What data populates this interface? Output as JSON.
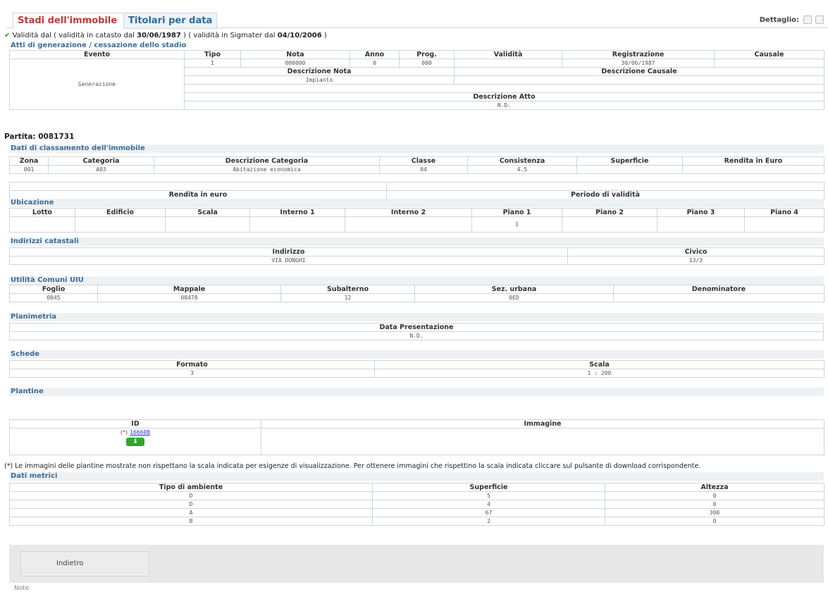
{
  "tabs": {
    "active": "Stadi dell'immobile",
    "inactive": "Titolari per data"
  },
  "detail_label": "Dettaglio:",
  "validity": {
    "prefix": "Validità dal",
    "text1": "( validità in catasto dal",
    "date1": "30/06/1987",
    "text2": ") ( validità in Sigmater dal",
    "date2": "04/10/2006",
    "text3": ")"
  },
  "atti": {
    "title": "Atti di generazione / cessazione dello stadio",
    "headers": [
      "Evento",
      "Tipo",
      "Nota",
      "Anno",
      "Prog.",
      "Validità",
      "Registrazione",
      "Causale"
    ],
    "evento": "Generazione",
    "row": [
      "I",
      "000000",
      "0",
      "000",
      "",
      "30/06/1987",
      ""
    ],
    "desc_nota_h": "Descrizione Nota",
    "desc_nota": "Impianto",
    "desc_causale_h": "Descrizione Causale",
    "desc_atto_h": "Descrizione Atto",
    "desc_atto": "N.D."
  },
  "partita": "Partita: 0081731",
  "classamento": {
    "title": "Dati di classamento dell'immobile",
    "headers": [
      "Zona",
      "Categoria",
      "Descrizione Categoria",
      "Classe",
      "Consistenza",
      "Superficie",
      "Rendita in Euro"
    ],
    "row": [
      "001",
      "A03",
      "Abitazione economica",
      "04",
      "4.5",
      "",
      ""
    ],
    "rendita_h": "Rendita in euro",
    "periodo_h": "Periodo di validità"
  },
  "ubicazione": {
    "title": "Ubicazione",
    "headers": [
      "Lotto",
      "Edificio",
      "Scala",
      "Interno 1",
      "Interno 2",
      "Piano 1",
      "Piano 2",
      "Piano 3",
      "Piano 4"
    ],
    "row": [
      "",
      "",
      "",
      "",
      "",
      "1",
      "",
      "",
      ""
    ]
  },
  "indirizzi": {
    "title": "Indirizzi catastali",
    "headers": [
      "Indirizzo",
      "Civico"
    ],
    "row": [
      "VIA DONGHI",
      "13/3"
    ]
  },
  "utilita": {
    "title": "Utilità Comuni UIU",
    "headers": [
      "Foglio",
      "Mappale",
      "Subalterno",
      "Sez. urbana",
      "Denominatore"
    ],
    "row": [
      "0045",
      "00478",
      "12",
      "0ED",
      ""
    ]
  },
  "planimetria": {
    "title": "Planimetria",
    "header": "Data Presentazione",
    "value": "N.D."
  },
  "schede": {
    "title": "Schede",
    "headers": [
      "Formato",
      "Scala"
    ],
    "row": [
      "3",
      "1 : 200"
    ]
  },
  "plantine": {
    "title": "Plantine",
    "headers": [
      "ID",
      "Immagine"
    ],
    "id_prefix": "(*)",
    "id_link": "166608",
    "download": "⬇"
  },
  "footnote": "(*) Le immagini delle plantine mostrate non rispettano la scala indicata per esigenze di visualizzazione. Per ottenere immagini che rispettino la scala indicata cliccare sul pulsante di download corrispondente.",
  "metrici": {
    "title": "Dati metrici",
    "headers": [
      "Tipo di ambiente",
      "Superficie",
      "Altezza"
    ],
    "rows": [
      [
        "D",
        "5",
        "0"
      ],
      [
        "D",
        "4",
        "0"
      ],
      [
        "A",
        "67",
        "300"
      ],
      [
        "B",
        "2",
        "0"
      ]
    ]
  },
  "back_button": "Indietro",
  "note_label": "Note"
}
